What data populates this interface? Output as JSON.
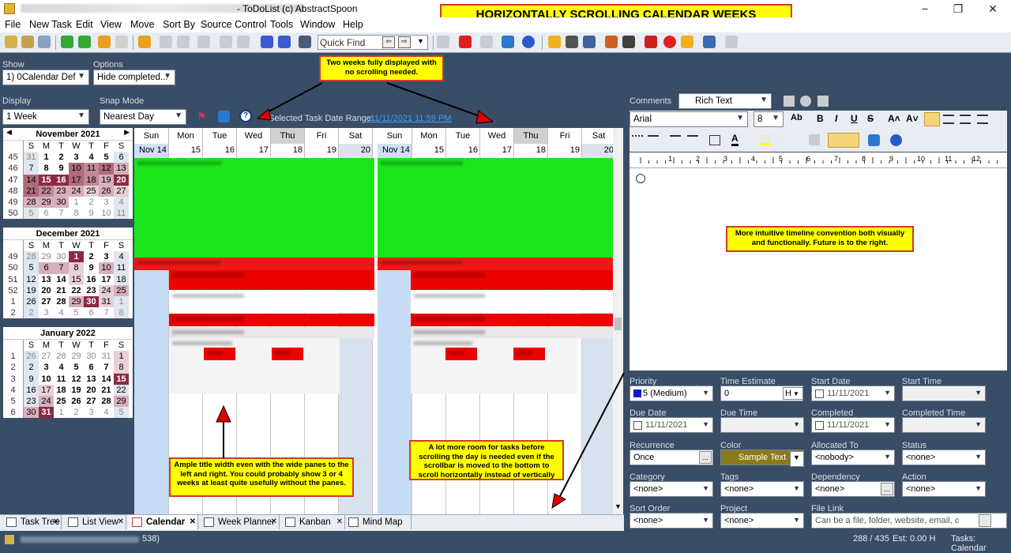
{
  "window": {
    "title": "- ToDoList (c) AbstractSpoon",
    "minimize": "−",
    "maximize": "❐",
    "close": "✕"
  },
  "banner": "HORIZONTALLY SCROLLING CALENDAR WEEKS",
  "menu": [
    "File",
    "New Task",
    "Edit",
    "View",
    "Move",
    "Sort By",
    "Source Control",
    "Tools",
    "Window",
    "Help"
  ],
  "quickfind": {
    "placeholder": "Quick Find"
  },
  "filters": {
    "show_label": "Show",
    "show_value": "1)  0Calendar Def",
    "options_label": "Options",
    "options_value": "Hide completed...",
    "display_label": "Display",
    "display_value": "1 Week",
    "snap_label": "Snap Mode",
    "snap_value": "Nearest Day",
    "date_range_label": "Selected Task Date Range:",
    "date_range_value": " - 11/11/2021 11:59 PM"
  },
  "annotations": {
    "two_weeks": "Two weeks fully displayed with no scrolling needed.",
    "timeline": "More intuitive timeline convention both visually and functionally.  Future is to the right.",
    "title_width": "Ample title width even with the wide panes to the left and right. You could probably show 3 or 4 weeks at least quite usefully without the panes.",
    "more_room": "A lot more room for tasks before scrolling the day is needed even if the scrollbar is moved to the bottom to scroll horizontally instead of vertically"
  },
  "minicals": [
    {
      "title": "November 2021",
      "days": [
        "S",
        "M",
        "T",
        "W",
        "T",
        "F",
        "S"
      ],
      "weeks": [
        [
          "45",
          "31",
          "1",
          "2",
          "3",
          "4",
          "5",
          "6"
        ],
        [
          "46",
          "7",
          "8",
          "9",
          "10",
          "11",
          "12",
          "13"
        ],
        [
          "47",
          "14",
          "15",
          "16",
          "17",
          "18",
          "19",
          "20"
        ],
        [
          "48",
          "21",
          "22",
          "23",
          "24",
          "25",
          "26",
          "27"
        ],
        [
          "49",
          "28",
          "29",
          "30",
          "1",
          "2",
          "3",
          "4"
        ],
        [
          "50",
          "5",
          "6",
          "7",
          "8",
          "9",
          "10",
          "11"
        ]
      ]
    },
    {
      "title": "December 2021",
      "days": [
        "S",
        "M",
        "T",
        "W",
        "T",
        "F",
        "S"
      ],
      "weeks": [
        [
          "49",
          "28",
          "29",
          "30",
          "1",
          "2",
          "3",
          "4"
        ],
        [
          "50",
          "5",
          "6",
          "7",
          "8",
          "9",
          "10",
          "11"
        ],
        [
          "51",
          "12",
          "13",
          "14",
          "15",
          "16",
          "17",
          "18"
        ],
        [
          "52",
          "19",
          "20",
          "21",
          "22",
          "23",
          "24",
          "25"
        ],
        [
          "1",
          "26",
          "27",
          "28",
          "29",
          "30",
          "31",
          "1"
        ],
        [
          "2",
          "2",
          "3",
          "4",
          "5",
          "6",
          "7",
          "8"
        ]
      ]
    },
    {
      "title": "January 2022",
      "days": [
        "S",
        "M",
        "T",
        "W",
        "T",
        "F",
        "S"
      ],
      "weeks": [
        [
          "1",
          "26",
          "27",
          "28",
          "29",
          "30",
          "31",
          "1"
        ],
        [
          "2",
          "2",
          "3",
          "4",
          "5",
          "6",
          "7",
          "8"
        ],
        [
          "3",
          "9",
          "10",
          "11",
          "12",
          "13",
          "14",
          "15"
        ],
        [
          "4",
          "16",
          "17",
          "18",
          "19",
          "20",
          "21",
          "22"
        ],
        [
          "5",
          "23",
          "24",
          "25",
          "26",
          "27",
          "28",
          "29"
        ],
        [
          "6",
          "30",
          "31",
          "1",
          "2",
          "3",
          "4",
          "5"
        ]
      ]
    }
  ],
  "week1": {
    "days": [
      "Sun",
      "Mon",
      "Tue",
      "Wed",
      "Thu",
      "Fri",
      "Sat"
    ],
    "dates": [
      "Nov 14",
      "15",
      "16",
      "17",
      "18",
      "19",
      "20"
    ]
  },
  "week2": {
    "days": [
      "Sun",
      "Mon",
      "Tue",
      "Wed",
      "Thu",
      "Fri",
      "Sat"
    ],
    "dates": [
      "Nov 14",
      "15",
      "16",
      "17",
      "18",
      "19",
      "20"
    ]
  },
  "comments": {
    "label": "Comments",
    "format": "Rich Text",
    "font": "Arial",
    "size": "8"
  },
  "props": {
    "priority_label": "Priority",
    "priority": "5 (Medium)",
    "time_est_label": "Time Estimate",
    "time_est": "0",
    "time_unit": "H",
    "start_date_label": "Start Date",
    "start_date": "11/11/2021",
    "start_time_label": "Start Time",
    "due_date_label": "Due Date",
    "due_date": "11/11/2021",
    "due_time_label": "Due Time",
    "completed_label": "Completed",
    "completed": "11/11/2021",
    "completed_time_label": "Completed Time",
    "recurrence_label": "Recurrence",
    "recurrence": "Once",
    "color_label": "Color",
    "color": "Sample Text",
    "allocated_label": "Allocated To",
    "allocated": "<nobody>",
    "status_label": "Status",
    "status": "<none>",
    "category_label": "Category",
    "category": "<none>",
    "tags_label": "Tags",
    "tags": "<none>",
    "dependency_label": "Dependency",
    "dependency": "<none>",
    "action_label": "Action",
    "action": "<none>",
    "sort_label": "Sort Order",
    "sort": "<none>",
    "project_label": "Project",
    "project": "<none>",
    "filelink_label": "File Link",
    "filelink": "Can be a file, folder, website, email, c"
  },
  "tabs": [
    "Task Tree",
    "List View",
    "Calendar",
    "Week Planner",
    "Kanban",
    "Mind Map"
  ],
  "status": {
    "counts": "288 / 435",
    "estimate": "Est: 0.00 H",
    "view": "Tasks: Calendar",
    "path_tail": "538)"
  },
  "colors": {
    "accent": "#3a4d66",
    "green": "#19e619",
    "red": "#ee0000",
    "annotation": "#ffff00"
  }
}
